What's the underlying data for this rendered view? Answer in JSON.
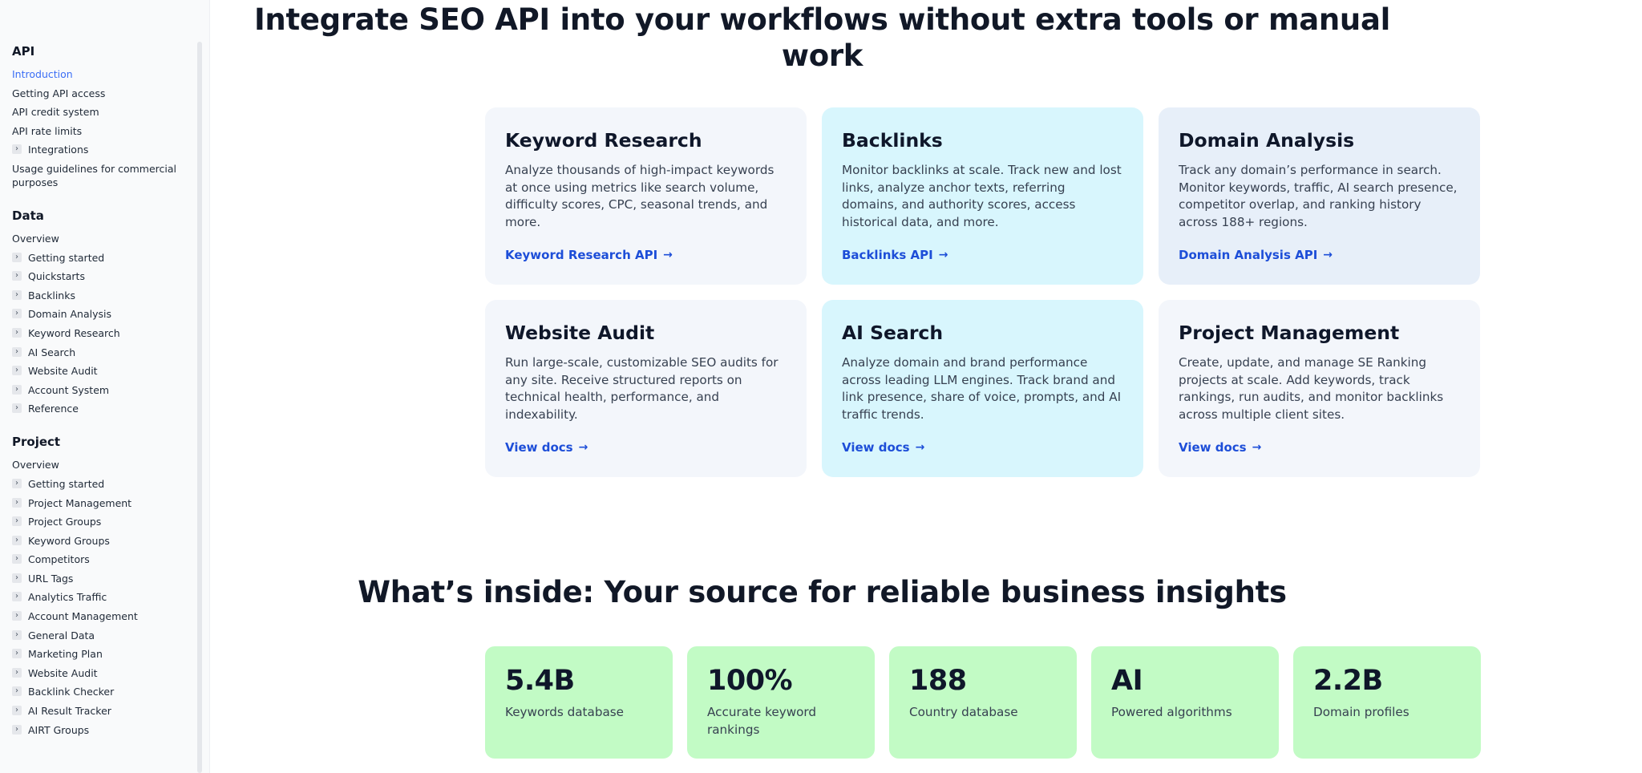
{
  "sidebar": {
    "sections": [
      {
        "title": "API",
        "items": [
          {
            "label": "Introduction",
            "expandable": false,
            "active": true
          },
          {
            "label": "Getting API access",
            "expandable": false
          },
          {
            "label": "API credit system",
            "expandable": false
          },
          {
            "label": "API rate limits",
            "expandable": false
          },
          {
            "label": "Integrations",
            "expandable": true
          },
          {
            "label": "Usage guidelines for commercial purposes",
            "expandable": false
          }
        ]
      },
      {
        "title": "Data",
        "items": [
          {
            "label": "Overview",
            "expandable": false
          },
          {
            "label": "Getting started",
            "expandable": true
          },
          {
            "label": "Quickstarts",
            "expandable": true
          },
          {
            "label": "Backlinks",
            "expandable": true
          },
          {
            "label": "Domain Analysis",
            "expandable": true
          },
          {
            "label": "Keyword Research",
            "expandable": true
          },
          {
            "label": "AI Search",
            "expandable": true
          },
          {
            "label": "Website Audit",
            "expandable": true
          },
          {
            "label": "Account System",
            "expandable": true
          },
          {
            "label": "Reference",
            "expandable": true
          }
        ]
      },
      {
        "title": "Project",
        "items": [
          {
            "label": "Overview",
            "expandable": false
          },
          {
            "label": "Getting started",
            "expandable": true
          },
          {
            "label": "Project Management",
            "expandable": true
          },
          {
            "label": "Project Groups",
            "expandable": true
          },
          {
            "label": "Keyword Groups",
            "expandable": true
          },
          {
            "label": "Competitors",
            "expandable": true
          },
          {
            "label": "URL Tags",
            "expandable": true
          },
          {
            "label": "Analytics Traffic",
            "expandable": true
          },
          {
            "label": "Account Management",
            "expandable": true
          },
          {
            "label": "General Data",
            "expandable": true
          },
          {
            "label": "Marketing Plan",
            "expandable": true
          },
          {
            "label": "Website Audit",
            "expandable": true
          },
          {
            "label": "Backlink Checker",
            "expandable": true
          },
          {
            "label": "AI Result Tracker",
            "expandable": true
          },
          {
            "label": "AIRT Groups",
            "expandable": true
          }
        ]
      }
    ]
  },
  "main": {
    "heading": "Integrate SEO API into your workflows without extra tools or manual work",
    "cards": [
      {
        "title": "Keyword Research",
        "description": "Analyze thousands of high-impact keywords at once using metrics like search volume, difficulty scores, CPC, seasonal trends, and more.",
        "link": "Keyword Research API",
        "color": "#f3f6fb"
      },
      {
        "title": "Backlinks",
        "description": "Monitor backlinks at scale. Track new and lost links, analyze anchor texts, referring domains, and authority scores, access historical data, and more.",
        "link": "Backlinks API",
        "color": "#d8f6fd"
      },
      {
        "title": "Domain Analysis",
        "description": "Track any domain’s performance in search. Monitor keywords, traffic, AI search presence, competitor overlap, and ranking history across 188+ regions.",
        "link": "Domain Analysis API",
        "color": "#e7eff9"
      },
      {
        "title": "Website Audit",
        "description": "Run large-scale, customizable SEO audits for any site. Receive structured reports on technical health, performance, and indexability.",
        "link": "View docs",
        "color": "#f3f6fb"
      },
      {
        "title": "AI Search",
        "description": "Analyze domain and brand performance across leading LLM engines. Track brand and link presence, share of voice, prompts, and AI traffic trends.",
        "link": "View docs",
        "color": "#d8f6fd"
      },
      {
        "title": "Project Management",
        "description": "Create, update, and manage SE Ranking projects at scale. Add keywords, track rankings, run audits, and monitor backlinks across multiple client sites.",
        "link": "View docs",
        "color": "#f3f6fb"
      }
    ],
    "insights_heading": "What’s inside: Your source for reliable business insights",
    "stats": [
      {
        "value": "5.4B",
        "label": "Keywords database"
      },
      {
        "value": "100%",
        "label": "Accurate keyword rankings"
      },
      {
        "value": "188",
        "label": "Country database"
      },
      {
        "value": "AI",
        "label": "Powered algorithms"
      },
      {
        "value": "2.2B",
        "label": "Domain profiles"
      }
    ]
  },
  "icons": {
    "expand": "chevron-right-icon",
    "link_arrow": "arrow-right-icon"
  },
  "colors": {
    "active_link": "#3b6ef5",
    "card_link": "#1d4ed8",
    "stat_bg": "#c2fbc5"
  }
}
